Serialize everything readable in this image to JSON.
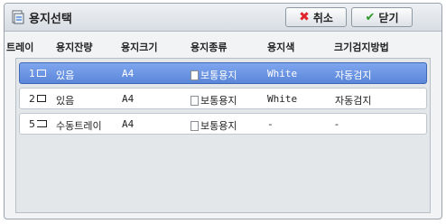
{
  "dialog": {
    "title": "용지선택",
    "cancel_label": "취소",
    "close_label": "닫기"
  },
  "columns": [
    "트레이",
    "용지잔량",
    "용지크기",
    "용지종류",
    "용지색",
    "크기검지방법"
  ],
  "rows": [
    {
      "tray": "1",
      "remaining": "있음",
      "size": "A4",
      "type": "보통용지",
      "color": "White",
      "detect": "자동검지",
      "selected": true
    },
    {
      "tray": "2",
      "remaining": "있음",
      "size": "A4",
      "type": "보통용지",
      "color": "White",
      "detect": "자동검지",
      "selected": false
    },
    {
      "tray": "5",
      "remaining": "수동트레이",
      "size": "A4",
      "type": "보통용지",
      "color": "-",
      "detect": "-",
      "selected": false
    }
  ],
  "colors": {
    "selected_row": "#6b95e3",
    "cancel_icon": "#e0242b",
    "close_icon": "#2f9a2b"
  }
}
